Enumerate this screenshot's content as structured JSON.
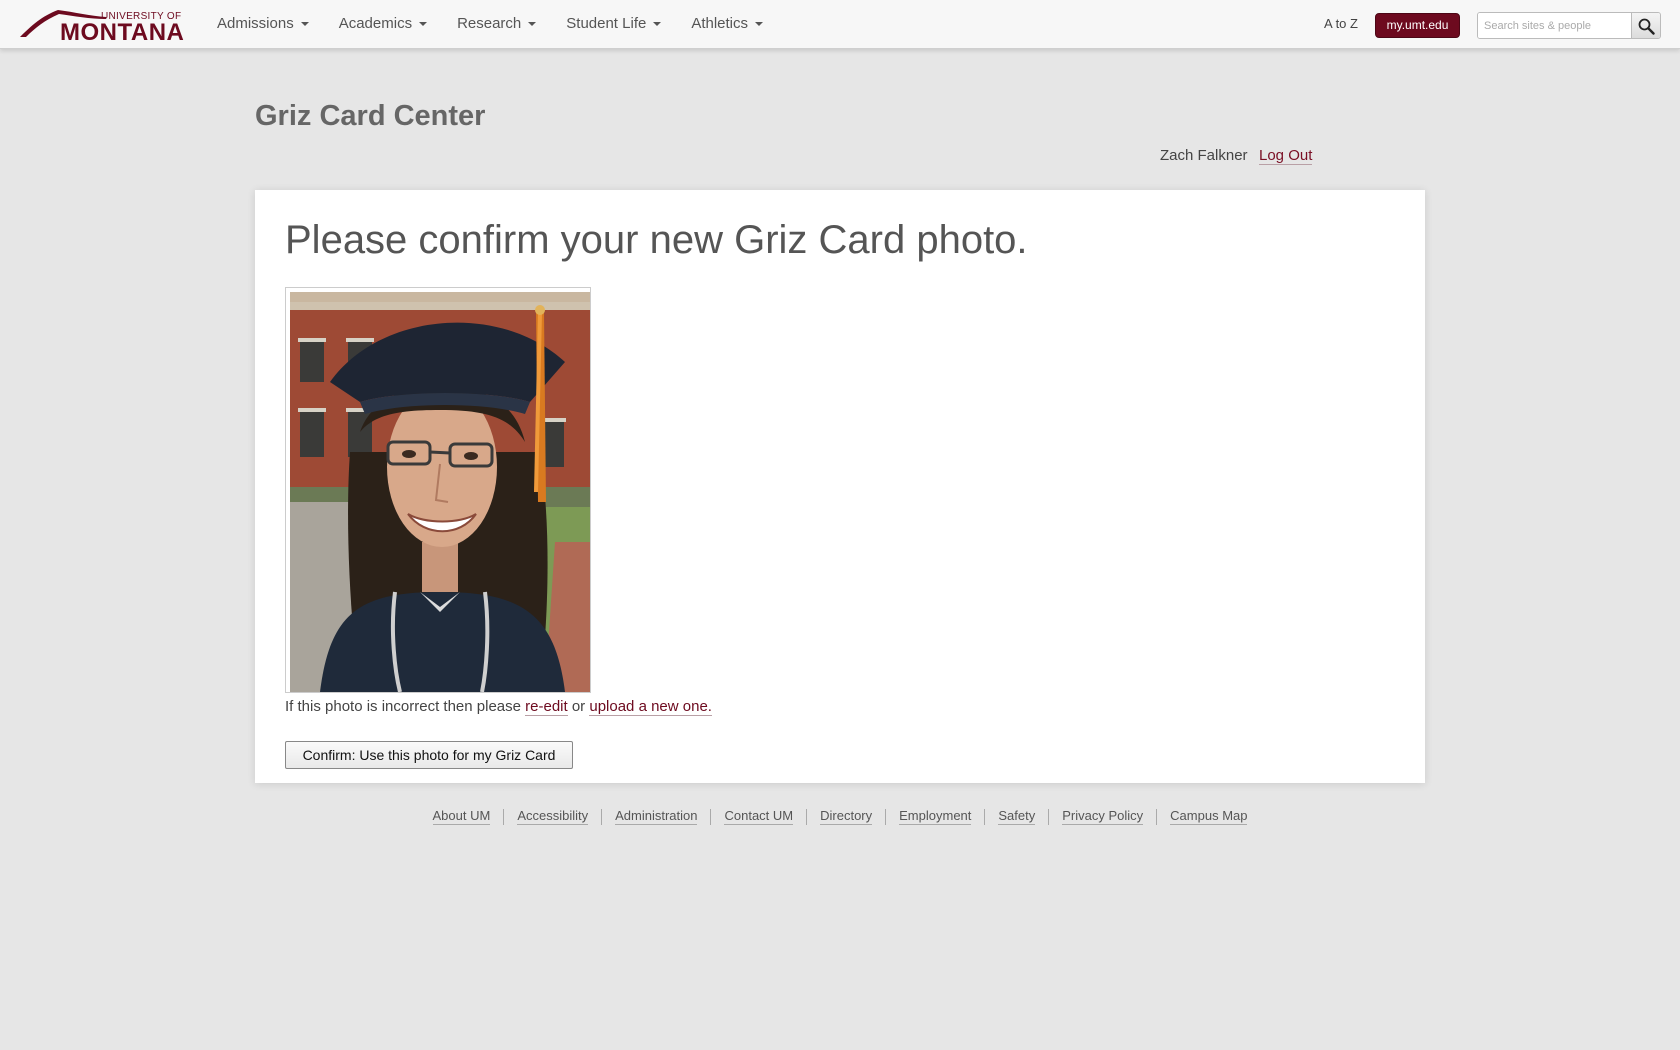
{
  "header": {
    "logo_small": "UNIVERSITY OF",
    "logo_big": "MONTANA",
    "nav": [
      {
        "label": "Admissions"
      },
      {
        "label": "Academics"
      },
      {
        "label": "Research"
      },
      {
        "label": "Student Life"
      },
      {
        "label": "Athletics"
      }
    ],
    "atoz": "A to Z",
    "my_link": "my.umt.edu",
    "search_placeholder": "Search sites & people",
    "brand_color": "#6d0a1f"
  },
  "page": {
    "title": "Griz Card Center",
    "user_name": "Zach Falkner",
    "logout": "Log Out"
  },
  "card": {
    "heading": "Please confirm your new Griz Card photo.",
    "help_prefix": "If this photo is incorrect then please",
    "reedit": "re-edit",
    "or": "or",
    "upload": "upload a new one.",
    "confirm_button": "Confirm: Use this photo for my Griz Card"
  },
  "footer": {
    "links": [
      {
        "label": "About UM"
      },
      {
        "label": "Accessibility"
      },
      {
        "label": "Administration"
      },
      {
        "label": "Contact UM"
      },
      {
        "label": "Directory"
      },
      {
        "label": "Employment"
      },
      {
        "label": "Safety"
      },
      {
        "label": "Privacy Policy"
      },
      {
        "label": "Campus Map"
      }
    ]
  }
}
